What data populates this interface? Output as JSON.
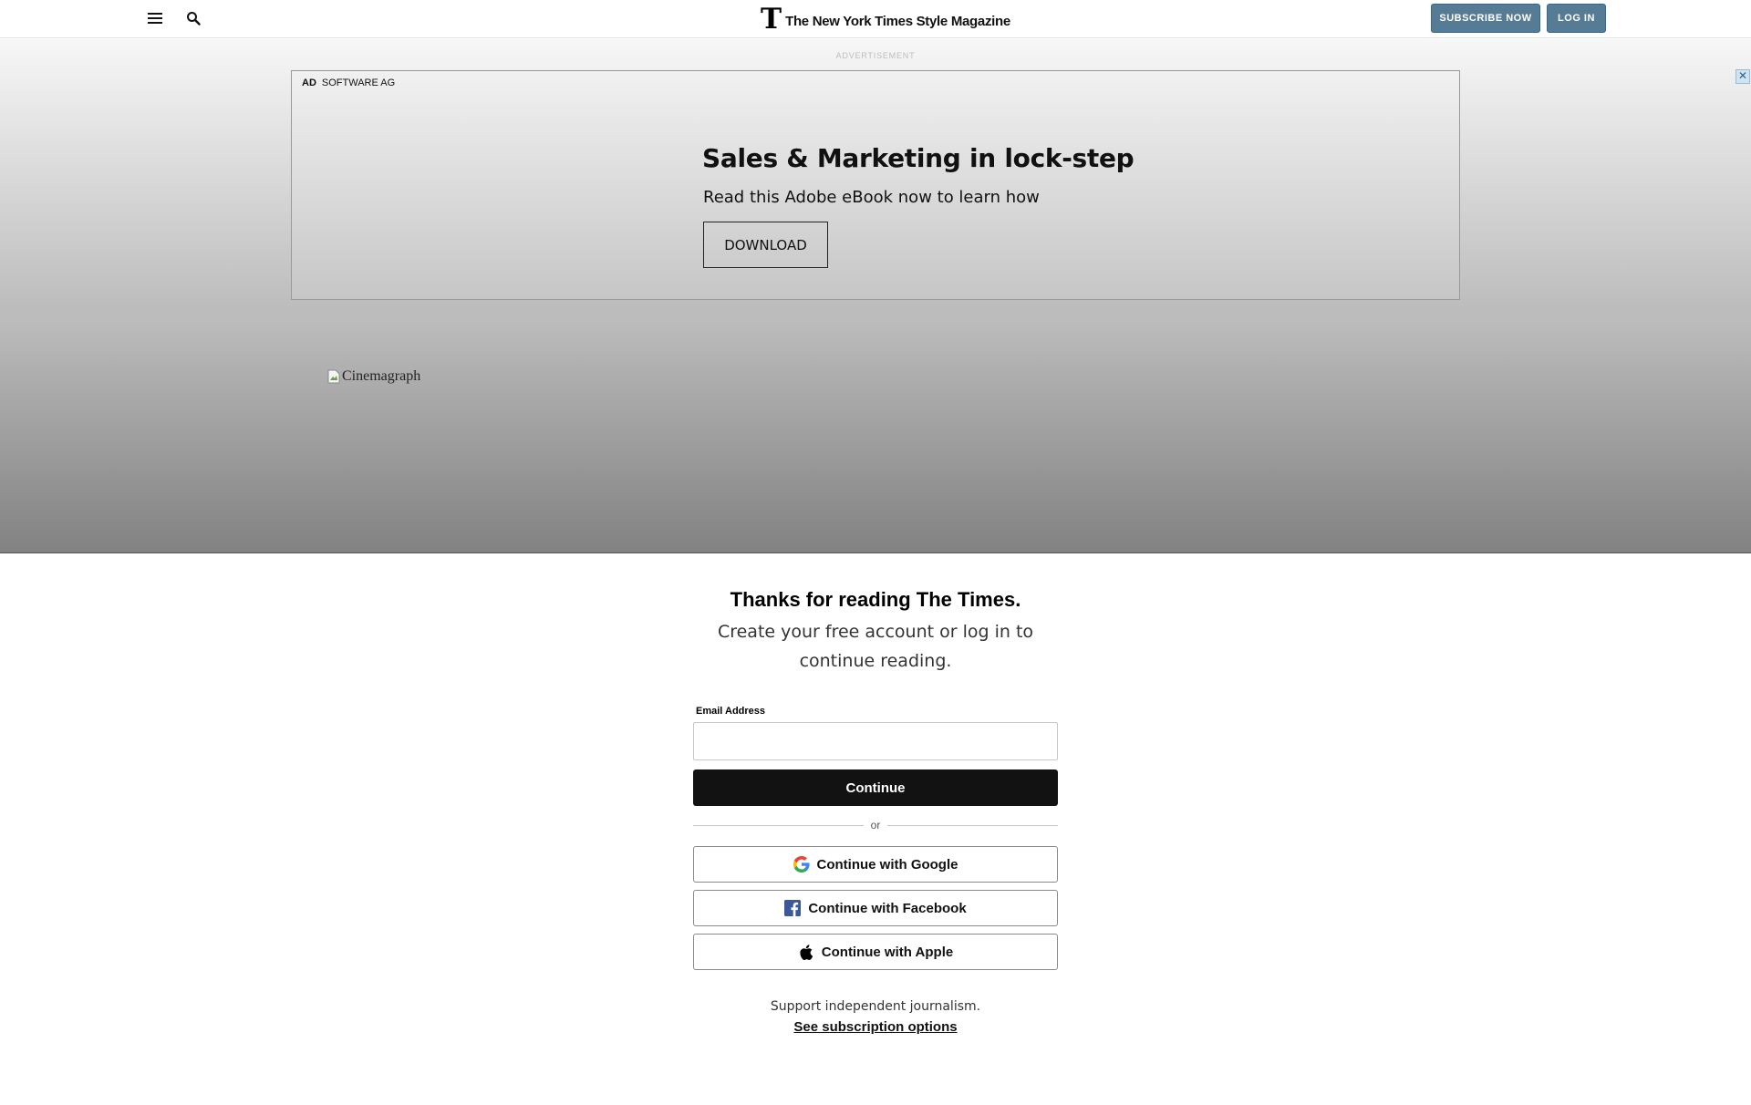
{
  "header": {
    "logo_text": "The New York Times Style Magazine",
    "logo_glyph": "T",
    "menu_icon": "hamburger-menu-icon",
    "search_icon": "magnifier-search-icon",
    "subscribe_label": "SUBSCRIBE NOW",
    "login_label": "LOG IN"
  },
  "ad": {
    "label": "ADVERTISEMENT",
    "tag": "AD",
    "advertiser": "SOFTWARE AG",
    "headline": "Sales & Marketing in lock-step",
    "subline": "Read this Adobe eBook now to learn how",
    "cta": "DOWNLOAD",
    "close_glyph": "✕"
  },
  "media": {
    "alt_text": "Cinemagraph"
  },
  "regwall": {
    "title": "Thanks for reading The Times.",
    "subtitle": "Create your free account or log in to continue reading.",
    "email_label": "Email Address",
    "email_value": "",
    "continue_label": "Continue",
    "or_text": "or",
    "google_label": "Continue with Google",
    "facebook_label": "Continue with Facebook",
    "apple_label": "Continue with Apple",
    "support_text": "Support independent journalism.",
    "subscription_link": "See subscription options"
  },
  "colors": {
    "subscribe_button": "#567b95",
    "continue_button": "#121212",
    "facebook_blue": "#3b5998"
  }
}
